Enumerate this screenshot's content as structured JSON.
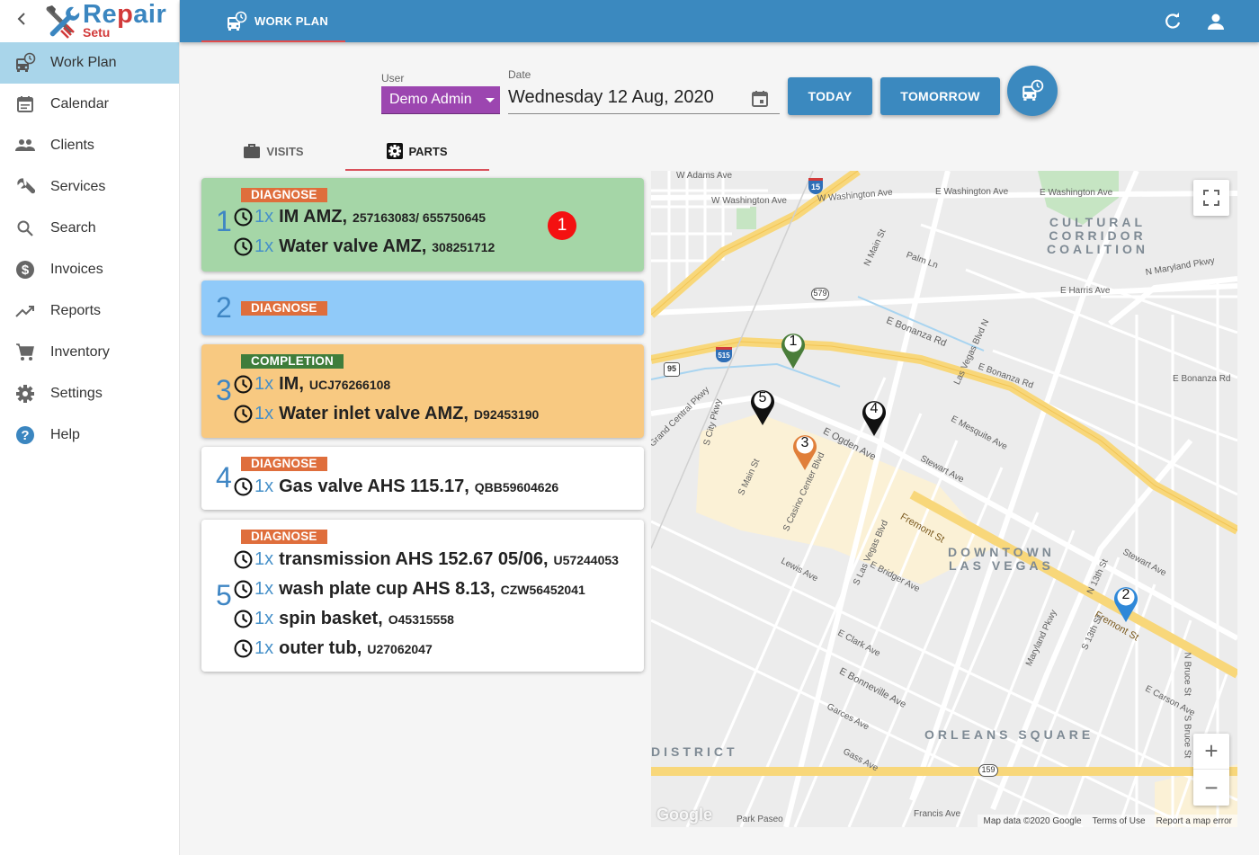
{
  "app": {
    "logo_main_a": "Re",
    "logo_main_b": "p",
    "logo_main_c": "air",
    "logo_sub": "Setu",
    "back_icon": "chevron-left-icon"
  },
  "sidebar": {
    "items": [
      {
        "label": "Work Plan",
        "icon": "bus-clock-icon",
        "active": true
      },
      {
        "label": "Calendar",
        "icon": "calendar-icon"
      },
      {
        "label": "Clients",
        "icon": "people-icon"
      },
      {
        "label": "Services",
        "icon": "wrench-icon"
      },
      {
        "label": "Search",
        "icon": "search-icon"
      },
      {
        "label": "Invoices",
        "icon": "dollar-icon"
      },
      {
        "label": "Reports",
        "icon": "trending-up-icon"
      },
      {
        "label": "Inventory",
        "icon": "cart-icon"
      },
      {
        "label": "Settings",
        "icon": "gear-icon"
      },
      {
        "label": "Help",
        "icon": "help-icon"
      }
    ]
  },
  "topbar": {
    "tab_label": "WORK PLAN",
    "refresh_icon": "refresh-icon",
    "account_icon": "account-icon"
  },
  "filters": {
    "user_label": "User",
    "user_value": "Demo Admin",
    "date_label": "Date",
    "date_value": "Wednesday 12 Aug, 2020",
    "today_label": "TODAY",
    "tomorrow_label": "TOMORROW"
  },
  "tabs": [
    {
      "label": "VISITS",
      "icon": "briefcase-icon",
      "active": false
    },
    {
      "label": "PARTS",
      "icon": "gear-box-icon",
      "active": true
    }
  ],
  "visits": [
    {
      "number": "1",
      "color": "#a5d6a7",
      "badge": "DIAGNOSE",
      "alert_count": "1",
      "parts": [
        {
          "qty": "1x",
          "name": "IM AMZ,",
          "code": "257163083/ 655750645"
        },
        {
          "qty": "1x",
          "name": "Water valve AMZ,",
          "code": "308251712"
        }
      ]
    },
    {
      "number": "2",
      "color": "#90caf9",
      "badge": "DIAGNOSE",
      "parts": []
    },
    {
      "number": "3",
      "color": "#f8c981",
      "badge": "COMPLETION",
      "parts": [
        {
          "qty": "1x",
          "name": "IM,",
          "code": "UCJ76266108"
        },
        {
          "qty": "1x",
          "name": "Water inlet valve AMZ,",
          "code": "D92453190"
        }
      ]
    },
    {
      "number": "4",
      "color": "#ffffff",
      "badge": "DIAGNOSE",
      "parts": [
        {
          "qty": "1x",
          "name": "Gas valve AHS 115.17,",
          "code": "QBB59604626"
        }
      ]
    },
    {
      "number": "5",
      "color": "#ffffff",
      "badge": "DIAGNOSE",
      "parts": [
        {
          "qty": "1x",
          "name": "transmission AHS 152.67 05/06,",
          "code": "U57244053"
        },
        {
          "qty": "1x",
          "name": "wash plate cup AHS 8.13,",
          "code": "CZW56452041"
        },
        {
          "qty": "1x",
          "name": "spin basket,",
          "code": "O45315558"
        },
        {
          "qty": "1x",
          "name": "outer tub,",
          "code": "U27062047"
        }
      ]
    }
  ],
  "map": {
    "pins": [
      {
        "label": "1",
        "color": "#4a7d3a"
      },
      {
        "label": "2",
        "color": "#2f88d8"
      },
      {
        "label": "3",
        "color": "#e07f3a"
      },
      {
        "label": "4",
        "color": "#111111"
      },
      {
        "label": "5",
        "color": "#111111"
      }
    ],
    "areas": {
      "cultural": "CULTURAL\nCORRIDOR\nCOALITION",
      "downtown": "DOWNTOWN\nLAS VEGAS",
      "orleans": "ORLEANS SQUARE",
      "district": "DISTRICT"
    },
    "streets": {
      "w_adams": "W Adams Ave",
      "w_washington": "W Washington Ave",
      "w_washington2": "W Washington Ave",
      "e_washington": "E Washington Ave",
      "e_washington2": "E Washington Ave",
      "n_main": "N Main St",
      "palm_ln": "Palm Ln",
      "e_bonanza": "E Bonanza Rd",
      "e_bonanza2": "E Bonanza Rd",
      "e_bonanza3": "E Bonanza Rd",
      "n_maryland": "N Maryland Pkwy",
      "e_harris": "E Harris Ave",
      "lv_blvd_n": "Las Vegas Blvd N",
      "e_ogden": "E Ogden Ave",
      "stewart": "Stewart Ave",
      "stewart2": "Stewart Ave",
      "fremont": "Fremont St",
      "fremont2": "Fremont St",
      "s_lv_blvd": "S Las Vegas Blvd",
      "e_bridger": "E Bridger Ave",
      "lewis": "Lewis Ave",
      "e_clark": "E Clark Ave",
      "e_bonneville": "E Bonneville Ave",
      "s_main": "S Main St",
      "s_casino": "S Casino Center Blvd",
      "grand_central": "Grand Central Pkwy",
      "s_city": "S City Pkwy",
      "maryland_pkwy": "Maryland Pkwy",
      "s_13th": "S 13th St",
      "n_13th": "N 13th St",
      "e_carson": "E Carson Ave",
      "n_bruce": "N Bruce St",
      "s_bruce": "S Bruce St",
      "e_mesquite": "E Mesquite Ave",
      "francis": "Francis Ave",
      "park_paseo": "Park Paseo",
      "garces": "Garces Ave",
      "gass": "Gass Ave"
    },
    "shields": {
      "i15": "15",
      "i515": "515",
      "us95": "95",
      "r579": "579",
      "r159": "159"
    },
    "footer": {
      "google": "Google",
      "map_data": "Map data ©2020 Google",
      "terms": "Terms of Use",
      "report": "Report a map error"
    },
    "zoom_in": "+",
    "zoom_out": "−"
  }
}
